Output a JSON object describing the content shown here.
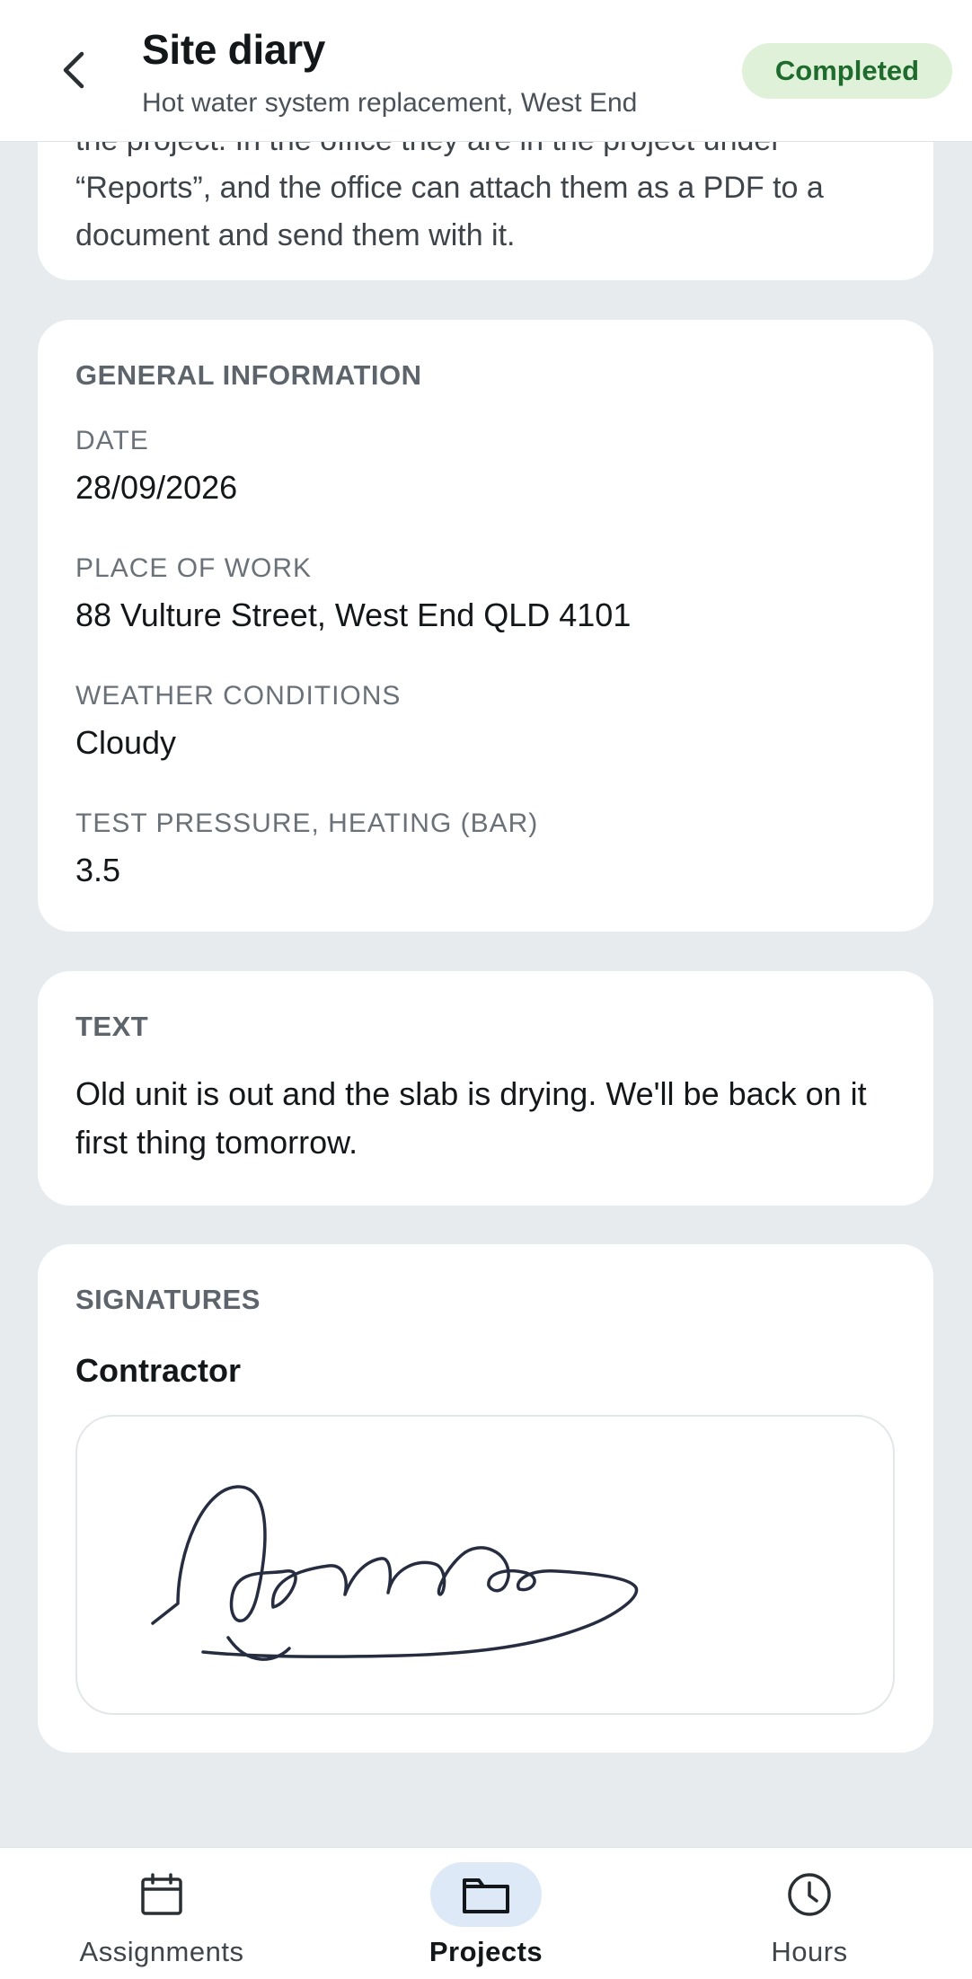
{
  "header": {
    "title": "Site diary",
    "subtitle": "Hot water system replacement, West End",
    "status": "Completed"
  },
  "partial_card": {
    "text": "the project. In the office they are in the project under “Reports”, and the office can attach them as a PDF to a document and send them with it."
  },
  "general": {
    "heading": "GENERAL INFORMATION",
    "fields": [
      {
        "label": "DATE",
        "value": "28/09/2026"
      },
      {
        "label": "PLACE OF WORK",
        "value": "88 Vulture Street, West End QLD 4101"
      },
      {
        "label": "WEATHER CONDITIONS",
        "value": "Cloudy"
      },
      {
        "label": "TEST PRESSURE, HEATING (BAR)",
        "value": "3.5"
      }
    ]
  },
  "text_section": {
    "heading": "TEXT",
    "body": "Old unit is out and the slab is drying. We'll be back on it first thing tomorrow."
  },
  "signatures": {
    "heading": "SIGNATURES",
    "signer": "Contractor"
  },
  "nav": {
    "items": [
      {
        "label": "Assignments",
        "icon": "calendar-icon",
        "active": false
      },
      {
        "label": "Projects",
        "icon": "folder-icon",
        "active": true
      },
      {
        "label": "Hours",
        "icon": "clock-icon",
        "active": false
      }
    ]
  },
  "colors": {
    "status_bg": "#dff1d8",
    "status_text": "#1f6b2e",
    "active_nav_bg": "#dde9f6",
    "page_bg": "#e8ebee"
  }
}
